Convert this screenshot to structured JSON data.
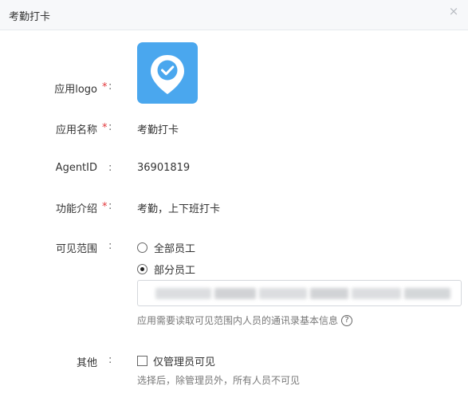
{
  "dialog": {
    "title": "考勤打卡",
    "close_symbol": "×"
  },
  "form": {
    "logo": {
      "label": "应用logo",
      "required": "*",
      "colon": ":",
      "icon": "location-check-icon",
      "icon_color": "#4aa7ee"
    },
    "name": {
      "label": "应用名称",
      "required": "*",
      "colon": ":",
      "value": "考勤打卡"
    },
    "agent": {
      "label": "AgentID",
      "colon": ":",
      "value": "36901819"
    },
    "intro": {
      "label": "功能介绍",
      "required": "*",
      "colon": ":",
      "value": "考勤，上下班打卡"
    },
    "scope": {
      "label": "可见范围",
      "colon": ":",
      "options": [
        "全部员工",
        "部分员工"
      ],
      "selected": "部分员工",
      "hint": "应用需要读取可见范围内人员的通讯录基本信息",
      "help_symbol": "?"
    },
    "other": {
      "label": "其他",
      "colon": ":",
      "checkbox_label": "仅管理员可见",
      "checked": false,
      "hint": "选择后，除管理员外，所有人员不可见"
    }
  }
}
